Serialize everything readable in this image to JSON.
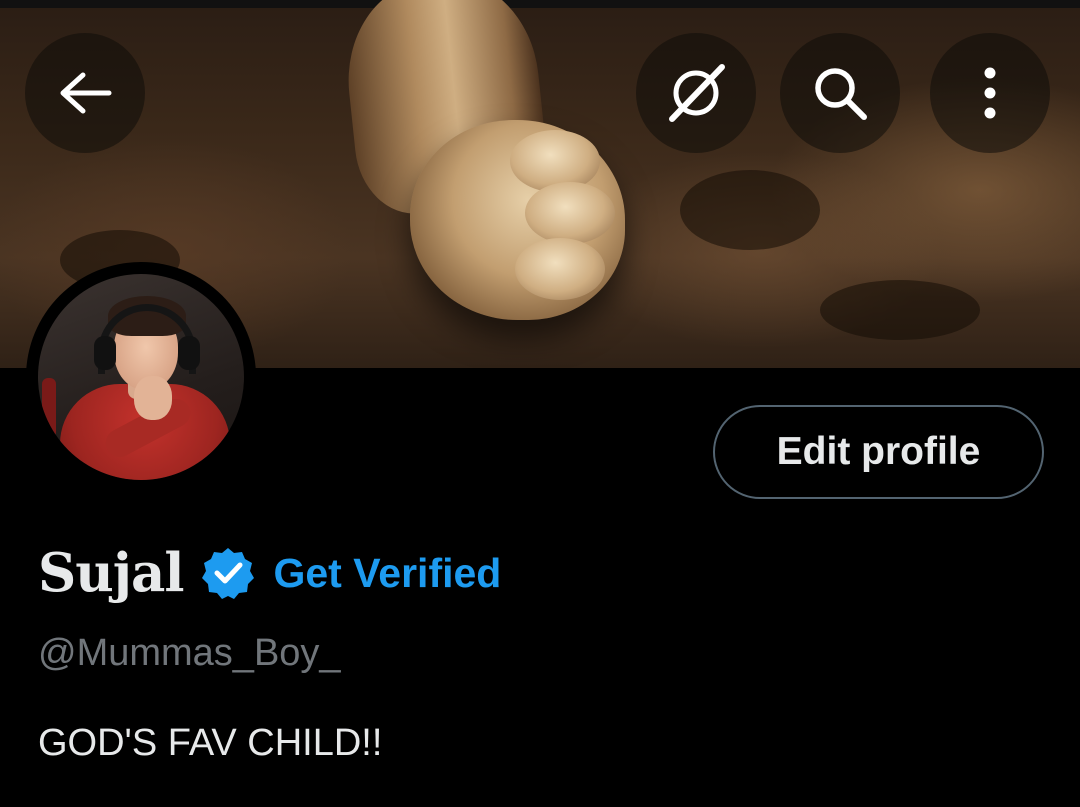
{
  "header": {
    "back_icon": "arrow-left-icon",
    "grok_icon": "slash-circle-icon",
    "search_icon": "search-icon",
    "more_icon": "more-vertical-icon"
  },
  "profile": {
    "display_name": "Sujal",
    "verified_badge_icon": "verified-badge-icon",
    "get_verified_label": "Get Verified",
    "handle": "@Mummas_Boy_",
    "bio": "GOD'S FAV CHILD!!",
    "edit_profile_label": "Edit profile"
  },
  "colors": {
    "background": "#000000",
    "accent": "#1d9bf0",
    "text_primary": "#e7e9ea",
    "text_secondary": "#71767b",
    "button_border": "#536471"
  }
}
